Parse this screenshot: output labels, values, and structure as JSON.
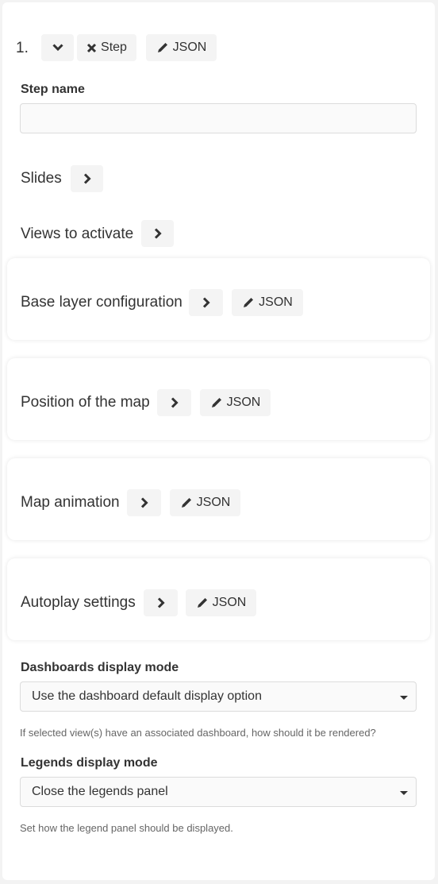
{
  "step": {
    "number": "1.",
    "remove_label": "Step",
    "json_label": "JSON"
  },
  "step_name": {
    "label": "Step name",
    "value": ""
  },
  "slides": {
    "label": "Slides"
  },
  "views": {
    "label": "Views to activate"
  },
  "sections": {
    "base_layer": {
      "label": "Base layer configuration",
      "json_label": "JSON"
    },
    "position": {
      "label": "Position of the map",
      "json_label": "JSON"
    },
    "animation": {
      "label": "Map animation",
      "json_label": "JSON"
    },
    "autoplay": {
      "label": "Autoplay settings",
      "json_label": "JSON"
    }
  },
  "dashboards": {
    "label": "Dashboards display mode",
    "selected": "Use the dashboard default display option",
    "help": "If selected view(s) have an associated dashboard, how should it be rendered?"
  },
  "legends": {
    "label": "Legends display mode",
    "selected": "Close the legends panel",
    "help": "Set how the legend panel should be displayed."
  },
  "icons": {
    "collapse": "chevron-down-icon",
    "remove": "x-icon",
    "edit": "pencil-icon",
    "expand": "chevron-right-icon",
    "dropdown": "caret-down-icon"
  }
}
